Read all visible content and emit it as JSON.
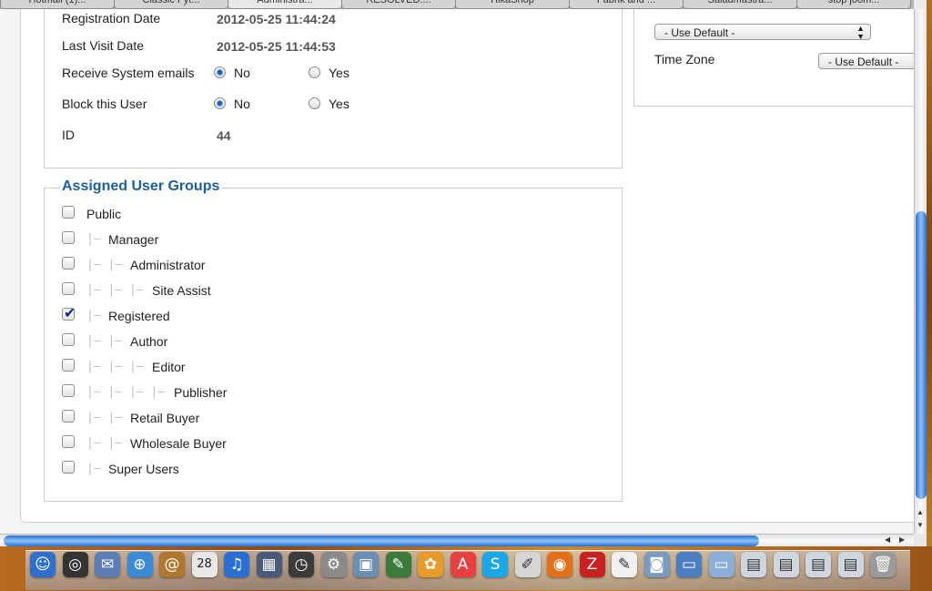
{
  "browser_tabs": [
    "Hotmail (1)...",
    "Classic Fyt...",
    "Administra...",
    "RESOLVED:...",
    "HikaShop",
    "Fabrik and ...",
    "Saladmastra...",
    "stop joom..."
  ],
  "details": {
    "registration_date_label": "Registration Date",
    "registration_date_value": "2012-05-25 11:44:24",
    "last_visit_label": "Last Visit Date",
    "last_visit_value": "2012-05-25 11:44:53",
    "receive_emails_label": "Receive System emails",
    "receive_emails_no": "No",
    "receive_emails_yes": "Yes",
    "receive_emails_selected": "No",
    "block_user_label": "Block this User",
    "block_user_no": "No",
    "block_user_yes": "Yes",
    "block_user_selected": "No",
    "id_label": "ID",
    "id_value": "44"
  },
  "groups": {
    "legend": "Assigned User Groups",
    "items": [
      {
        "label": "Public",
        "depth": 0,
        "checked": false
      },
      {
        "label": "Manager",
        "depth": 1,
        "checked": false
      },
      {
        "label": "Administrator",
        "depth": 2,
        "checked": false
      },
      {
        "label": "Site Assist",
        "depth": 3,
        "checked": false
      },
      {
        "label": "Registered",
        "depth": 1,
        "checked": true
      },
      {
        "label": "Author",
        "depth": 2,
        "checked": false
      },
      {
        "label": "Editor",
        "depth": 3,
        "checked": false
      },
      {
        "label": "Publisher",
        "depth": 4,
        "checked": false
      },
      {
        "label": "Retail Buyer",
        "depth": 2,
        "checked": false
      },
      {
        "label": "Wholesale Buyer",
        "depth": 2,
        "checked": false
      },
      {
        "label": "Super Users",
        "depth": 1,
        "checked": false
      }
    ]
  },
  "settings": {
    "select_default": "- Use Default -",
    "timezone_label": "Time Zone",
    "timezone_value": "- Use Default -"
  },
  "dock": {
    "calendar_day": "28",
    "apps": [
      "finder-icon",
      "dashboard-icon",
      "mail-icon",
      "safari-icon",
      "addressbook-icon",
      "ical-icon",
      "itunes-icon",
      "spaces-icon",
      "timemachine-icon",
      "systemprefs-icon",
      "iphoto-icon",
      "quill-icon",
      "flower-icon",
      "pdf-icon",
      "skype-icon",
      "preview-icon",
      "firefox-icon",
      "filezilla-icon",
      "textedit-icon",
      "iphoto2-icon",
      "folder-icon",
      "folder2-icon",
      "window1-icon",
      "window2-icon",
      "window3-icon",
      "window4-icon",
      "trash-icon"
    ]
  },
  "colors": {
    "accent": "#1d5f9a",
    "scroll": "#2a6fd4"
  }
}
